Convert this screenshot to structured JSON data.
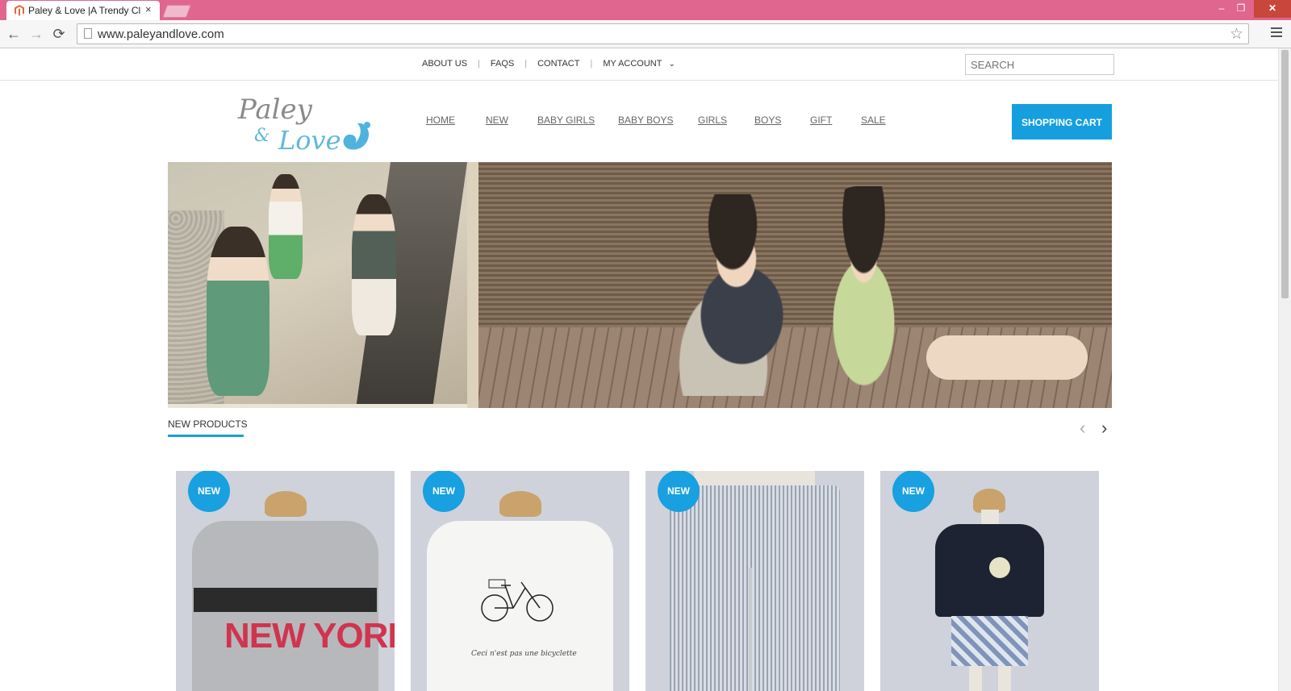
{
  "browser": {
    "tab_title": "Paley & Love |A Trendy Cl",
    "tab_close": "×",
    "url": "www.paleyandlove.com",
    "window_controls": {
      "minimize": "–",
      "maximize": "❐",
      "close": "✕"
    },
    "nav_icons": {
      "back": "←",
      "forward": "→",
      "reload": "⟳",
      "star": "☆"
    }
  },
  "topbar": {
    "links": {
      "about": "ABOUT US",
      "faqs": "FAQS",
      "contact": "CONTACT",
      "account": "MY ACCOUNT"
    },
    "search_placeholder": "SEARCH"
  },
  "logo": {
    "text_line1": "Paley",
    "text_amp": "&",
    "text_line2": "Love"
  },
  "nav": {
    "home": "HOME",
    "new": "NEW",
    "baby_girls": "BABY GIRLS",
    "baby_boys": "BABY BOYS",
    "girls": "GIRLS",
    "boys": "BOYS",
    "gift": "GIFT",
    "sale": "SALE"
  },
  "cart_label": "SHOPPING CART",
  "new_products": {
    "title": "NEW PRODUCTS",
    "prev": "‹",
    "next": "›",
    "badge": "NEW",
    "items": [
      {
        "graphic_text": "NEW YORK"
      },
      {
        "graphic_text": "Ceci n'est pas une bicyclette"
      },
      {
        "graphic_text": ""
      },
      {
        "graphic_text": ""
      }
    ]
  },
  "colors": {
    "accent": "#169fdf",
    "titlebar": "#e0668f",
    "nav_text": "#666666"
  }
}
